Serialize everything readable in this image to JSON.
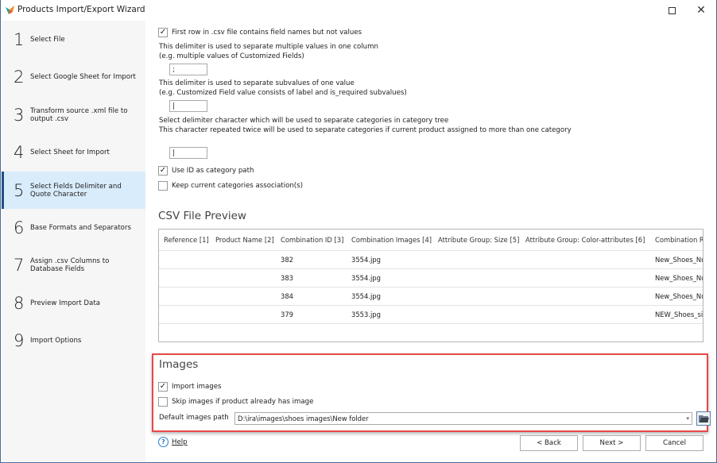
{
  "window": {
    "title": "Products Import/Export Wizard",
    "maximize_icon": "maximize-icon",
    "close_icon": "close-icon",
    "close_glyph": "✕"
  },
  "sidebar": {
    "active_index": 4,
    "steps": [
      {
        "num": "1",
        "label": "Select File"
      },
      {
        "num": "2",
        "label": "Select Google Sheet for Import"
      },
      {
        "num": "3",
        "label": "Transform source .xml file to output .csv"
      },
      {
        "num": "4",
        "label": "Select Sheet for Import"
      },
      {
        "num": "5",
        "label": "Select Fields Delimiter and Quote Character"
      },
      {
        "num": "6",
        "label": "Base Formats and Separators"
      },
      {
        "num": "7",
        "label": "Assign .csv Columns to Database Fields"
      },
      {
        "num": "8",
        "label": "Preview Import Data"
      },
      {
        "num": "9",
        "label": "Import Options"
      }
    ]
  },
  "options": {
    "first_row": {
      "label": "First row in .csv file contains field names but not values",
      "checked": true
    },
    "multi_value_note_1": "This delimiter is used to separate multiple values in one column",
    "multi_value_note_2": "(e.g. multiple values of Customized Fields)",
    "multi_value_delimiter": ";",
    "subvalue_note_1": "This delimiter is used to separate subvalues of one value",
    "subvalue_note_2": "(e.g. Customized Field value consists of label and is_required subvalues)",
    "subvalue_delimiter": "|",
    "category_note_1": "Select delimiter character which will be used to separate categories in category tree",
    "category_note_2": "This character repeated twice will be used to separate categories if current product assigned to more than one category",
    "category_delimiter": "|",
    "use_id": {
      "label": "Use ID as category path",
      "checked": true
    },
    "keep_categories": {
      "label": "Keep current categories association(s)",
      "checked": false
    },
    "check_glyph": "✓"
  },
  "preview": {
    "title": "CSV File Preview",
    "columns": [
      "Reference [1]",
      "Product Name [2]",
      "Combination ID [3]",
      "Combination Images [4]",
      "Attribute Group: Size [5]",
      "Attribute Group: Color-attributes [6]",
      "Combination R"
    ],
    "rows": [
      {
        "reference": "",
        "product_name": "",
        "combination_id": "382",
        "combination_images": "3554.jpg",
        "size": "",
        "color": "",
        "combination_ref": "New_Shoes_Nu"
      },
      {
        "reference": "",
        "product_name": "",
        "combination_id": "383",
        "combination_images": "3554.jpg",
        "size": "",
        "color": "",
        "combination_ref": "New_Shoes_Nu"
      },
      {
        "reference": "",
        "product_name": "",
        "combination_id": "384",
        "combination_images": "3554.jpg",
        "size": "",
        "color": "",
        "combination_ref": "New_Shoes_Nu"
      },
      {
        "reference": "",
        "product_name": "",
        "combination_id": "379",
        "combination_images": "3553.jpg",
        "size": "",
        "color": "",
        "combination_ref": "NEW_Shoes_sil"
      }
    ]
  },
  "images": {
    "title": "Images",
    "import_images": {
      "label": "Import images",
      "checked": true
    },
    "skip_images": {
      "label": "Skip images if product already has image",
      "checked": false
    },
    "path_label": "Default images path",
    "path_value": "D:\\ira\\images\\shoes images\\New folder",
    "dropdown_glyph": "▾",
    "highlight_color": "#e84848"
  },
  "footer": {
    "help_label": "Help",
    "help_glyph": "?",
    "back_label": "< Back",
    "next_label": "Next >",
    "cancel_label": "Cancel"
  }
}
